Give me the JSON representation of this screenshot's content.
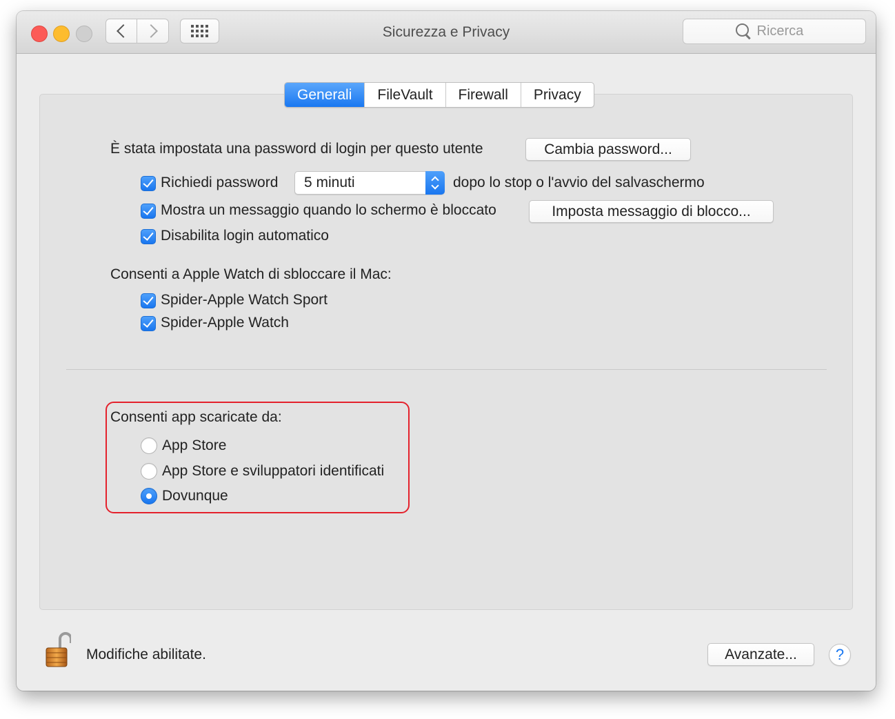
{
  "window": {
    "title": "Sicurezza e Privacy",
    "search_placeholder": "Ricerca"
  },
  "tabs": [
    {
      "label": "Generali",
      "active": true
    },
    {
      "label": "FileVault",
      "active": false
    },
    {
      "label": "Firewall",
      "active": false
    },
    {
      "label": "Privacy",
      "active": false
    }
  ],
  "general": {
    "login_password_text": "È stata impostata una password di login per questo utente",
    "change_password_button": "Cambia password...",
    "require_password": {
      "label": "Richiedi password",
      "checked": true
    },
    "require_password_delay": "5 minuti",
    "require_password_suffix": "dopo lo stop o l'avvio del salvaschermo",
    "show_message": {
      "label": "Mostra un messaggio quando lo schermo è bloccato",
      "checked": true
    },
    "set_lock_message_button": "Imposta messaggio di blocco...",
    "disable_autologin": {
      "label": "Disabilita login automatico",
      "checked": true
    },
    "apple_watch_heading": "Consenti a Apple Watch di sbloccare il Mac:",
    "watches": [
      {
        "label": "Spider-Apple Watch Sport",
        "checked": true
      },
      {
        "label": "Spider-Apple Watch",
        "checked": true
      }
    ],
    "allow_apps_heading": "Consenti app scaricate da:",
    "allow_apps_options": [
      {
        "label": "App Store",
        "selected": false
      },
      {
        "label": "App Store e sviluppatori identificati",
        "selected": false
      },
      {
        "label": "Dovunque",
        "selected": true
      }
    ]
  },
  "footer": {
    "status_text": "Modifiche abilitate.",
    "advanced_button": "Avanzate...",
    "help_button": "?"
  },
  "colors": {
    "accent": "#1a78f1",
    "highlight_border": "#e4212c"
  }
}
